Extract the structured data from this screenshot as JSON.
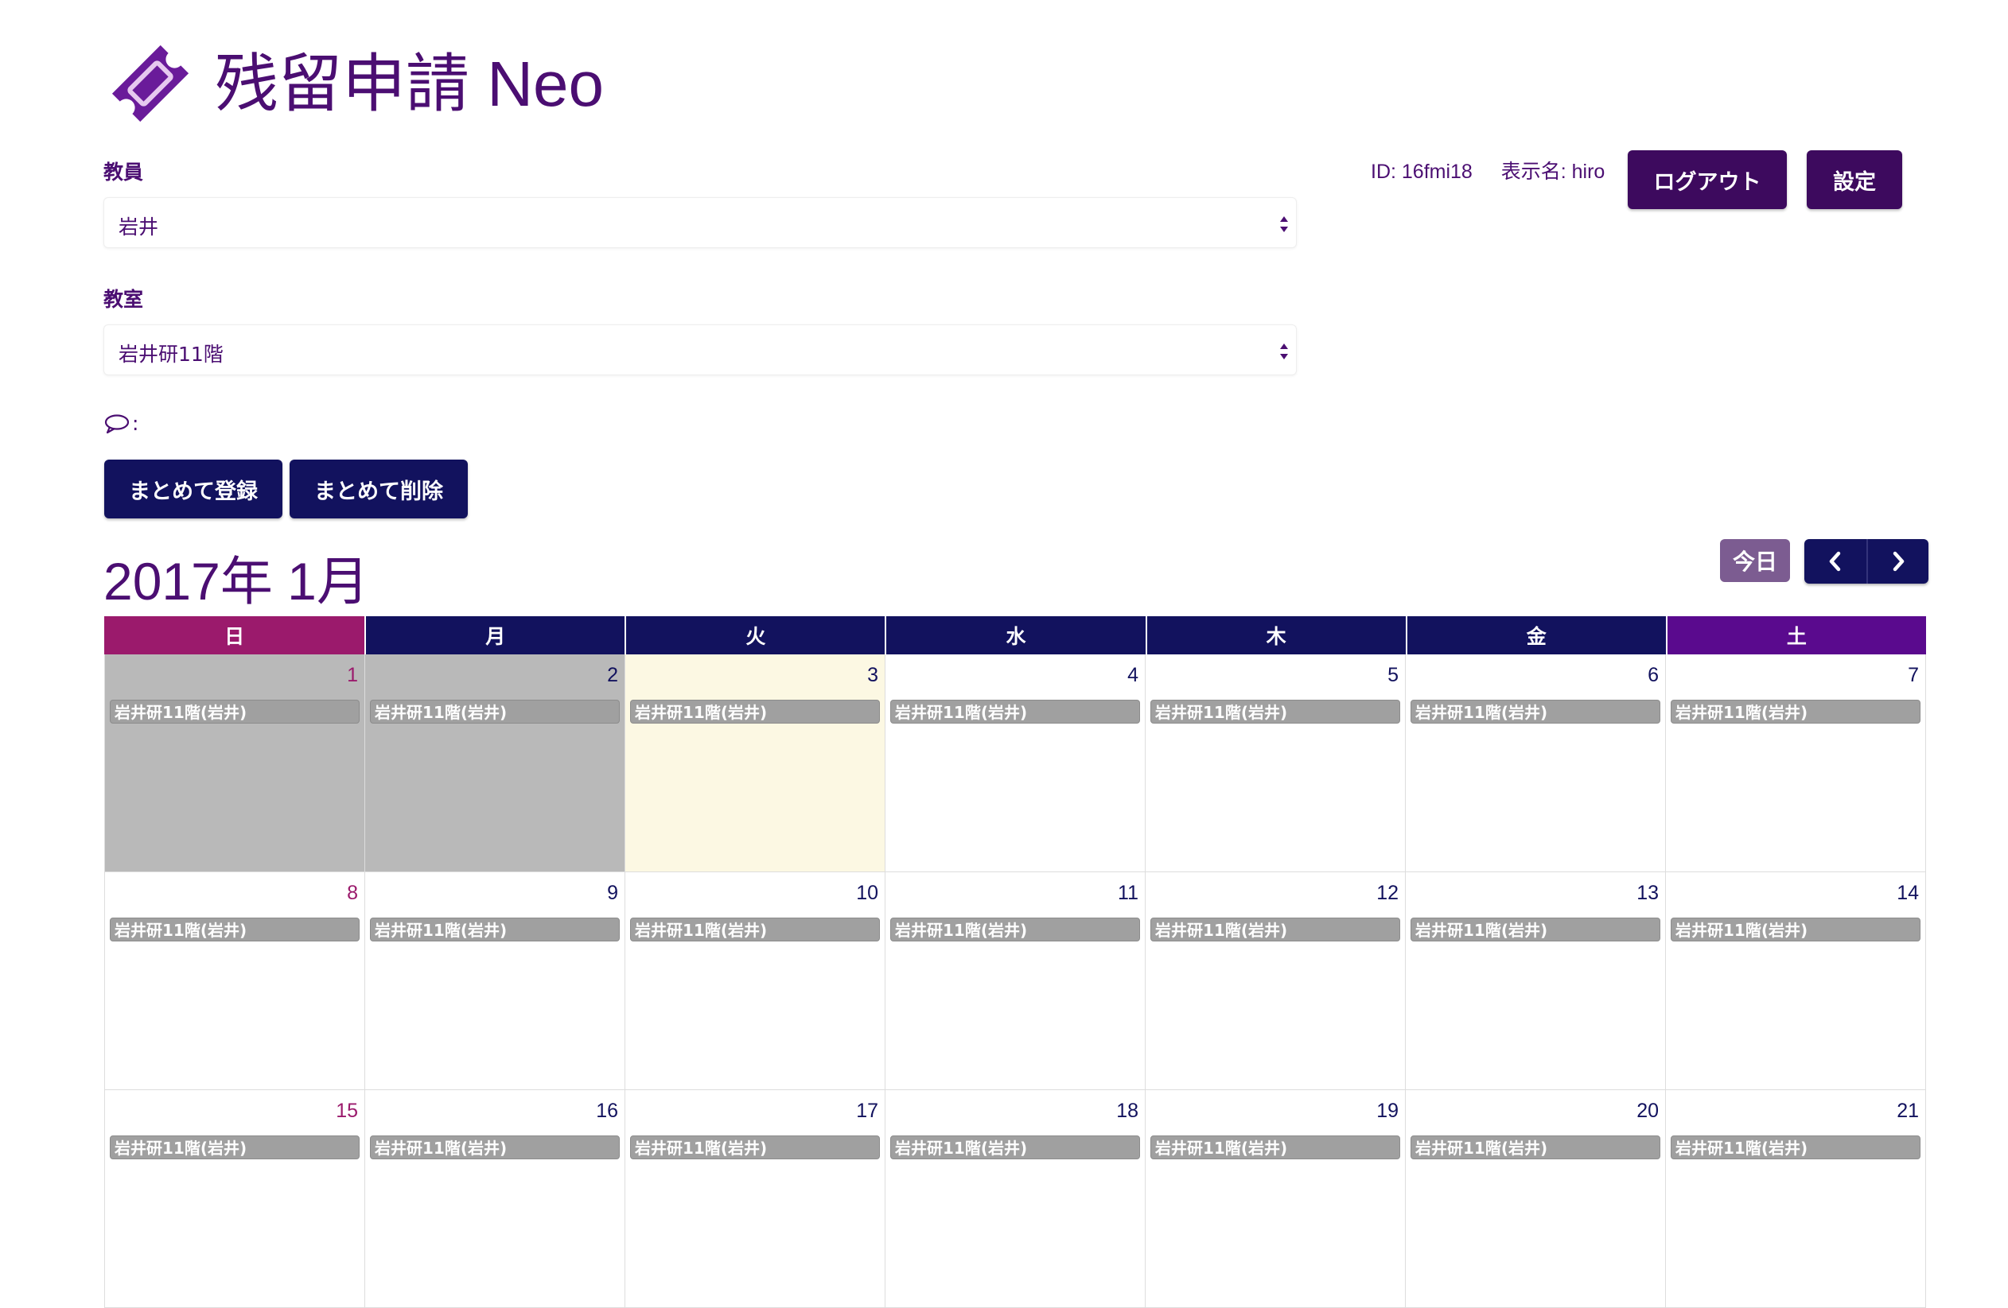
{
  "app": {
    "title": "残留申請 Neo",
    "logo_icon": "ticket-icon",
    "accent_color": "#4b0e72"
  },
  "form": {
    "teacher_label": "教員",
    "teacher_value": "岩井",
    "room_label": "教室",
    "room_value": "岩井研11階",
    "comment_label": ":",
    "comment_icon": "speech-bubble-icon"
  },
  "user": {
    "id_text": "ID: 16fmi18",
    "display_name_text": "表示名: hiro"
  },
  "actions": {
    "logout_label": "ログアウト",
    "settings_label": "設定",
    "bulk_register_label": "まとめて登録",
    "bulk_delete_label": "まとめて削除"
  },
  "calendar": {
    "month_title": "2017年 1月",
    "today_label": "今日",
    "prev_icon": "chevron-left-icon",
    "next_icon": "chevron-right-icon",
    "weekdays": [
      "日",
      "月",
      "火",
      "水",
      "木",
      "金",
      "土"
    ],
    "weekday_colors": [
      "#9b1a6c",
      "#12125e",
      "#12125e",
      "#12125e",
      "#12125e",
      "#12125e",
      "#5a0a8e"
    ],
    "days": [
      {
        "date": "1",
        "event": "岩井研11階(岩井)",
        "state": "past"
      },
      {
        "date": "2",
        "event": "岩井研11階(岩井)",
        "state": "past"
      },
      {
        "date": "3",
        "event": "岩井研11階(岩井)",
        "state": "today"
      },
      {
        "date": "4",
        "event": "岩井研11階(岩井)",
        "state": "future"
      },
      {
        "date": "5",
        "event": "岩井研11階(岩井)",
        "state": "future"
      },
      {
        "date": "6",
        "event": "岩井研11階(岩井)",
        "state": "future"
      },
      {
        "date": "7",
        "event": "岩井研11階(岩井)",
        "state": "future"
      },
      {
        "date": "8",
        "event": "岩井研11階(岩井)",
        "state": "future"
      },
      {
        "date": "9",
        "event": "岩井研11階(岩井)",
        "state": "future"
      },
      {
        "date": "10",
        "event": "岩井研11階(岩井)",
        "state": "future"
      },
      {
        "date": "11",
        "event": "岩井研11階(岩井)",
        "state": "future"
      },
      {
        "date": "12",
        "event": "岩井研11階(岩井)",
        "state": "future"
      },
      {
        "date": "13",
        "event": "岩井研11階(岩井)",
        "state": "future"
      },
      {
        "date": "14",
        "event": "岩井研11階(岩井)",
        "state": "future"
      },
      {
        "date": "15",
        "event": "岩井研11階(岩井)",
        "state": "future"
      },
      {
        "date": "16",
        "event": "岩井研11階(岩井)",
        "state": "future"
      },
      {
        "date": "17",
        "event": "岩井研11階(岩井)",
        "state": "future"
      },
      {
        "date": "18",
        "event": "岩井研11階(岩井)",
        "state": "future"
      },
      {
        "date": "19",
        "event": "岩井研11階(岩井)",
        "state": "future"
      },
      {
        "date": "20",
        "event": "岩井研11階(岩井)",
        "state": "future"
      },
      {
        "date": "21",
        "event": "岩井研11階(岩井)",
        "state": "future"
      }
    ]
  }
}
